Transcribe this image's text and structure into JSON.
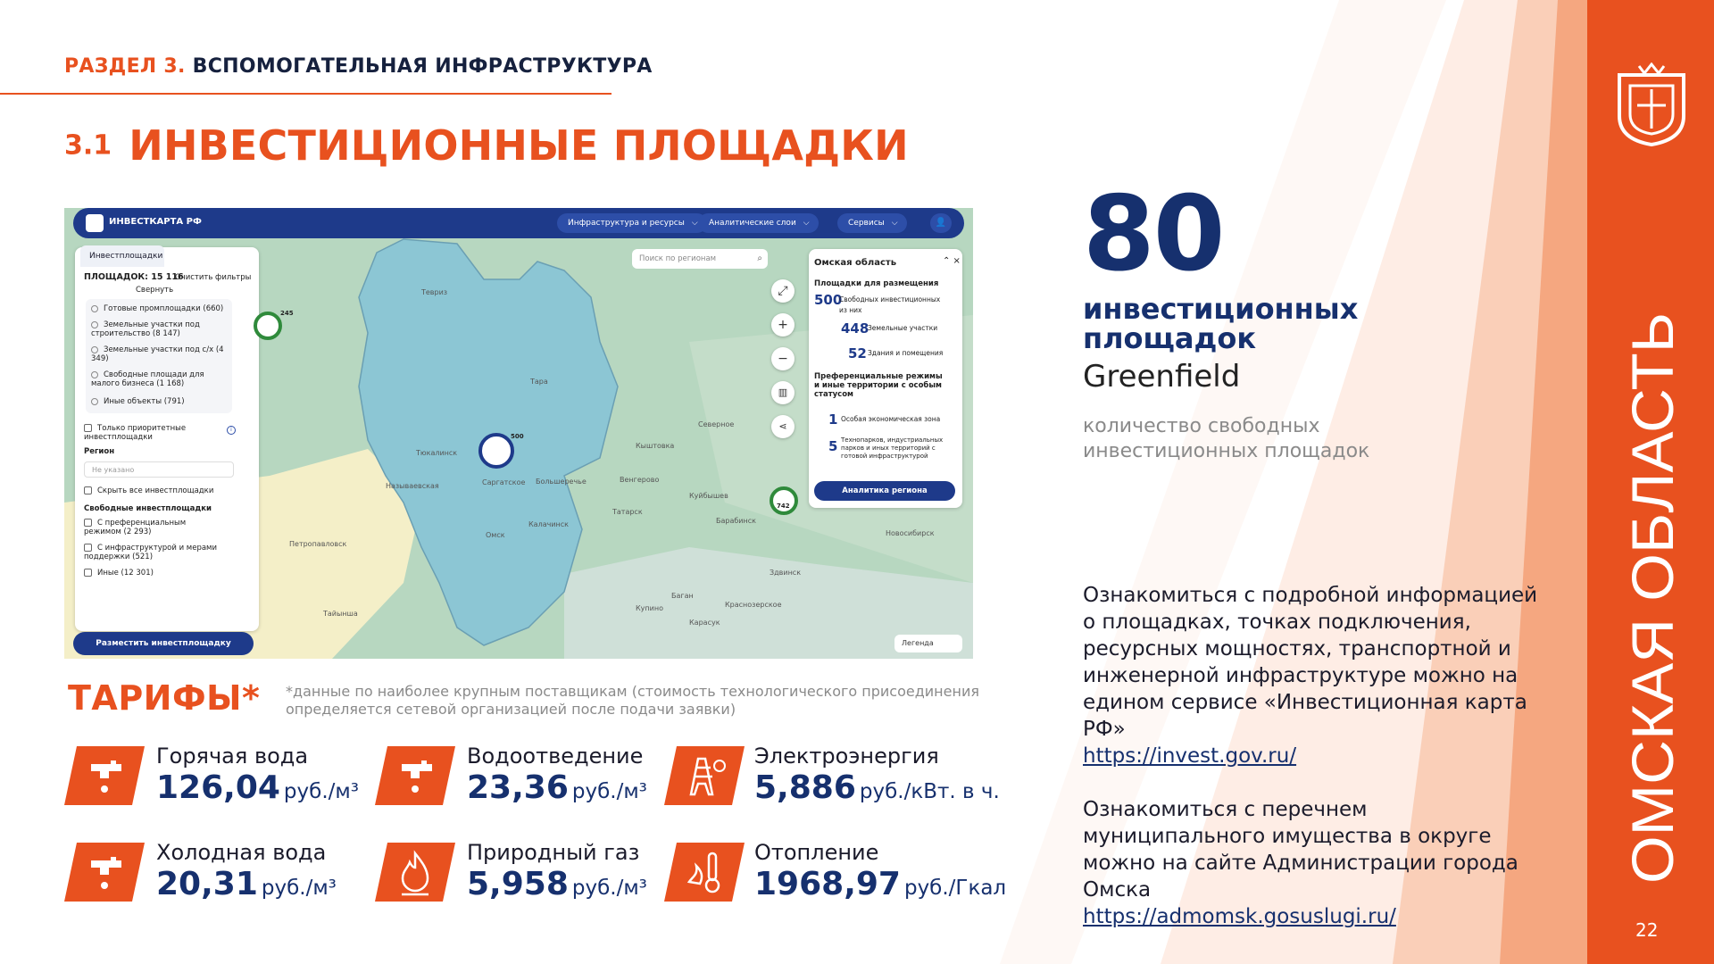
{
  "header": {
    "section_num": "РАЗДЕЛ 3.",
    "section_title": "ВСПОМОГАТЕЛЬНАЯ ИНФРАСТРУКТУРА",
    "title_num": "3.1",
    "title": "ИНВЕСТИЦИОННЫЕ ПЛОЩАДКИ"
  },
  "map": {
    "logo": "ИНВЕСТКАРТА РФ",
    "nav": [
      "Инфраструктура и ресурсы",
      "Аналитические слои",
      "Сервисы"
    ],
    "left_panel": {
      "tab": "Инвестплощадки",
      "count": "ПЛОЩАДОК: 15 116",
      "clear": "Очистить фильтры",
      "collapse": "Свернуть",
      "types": [
        "Готовые промплощадки (660)",
        "Земельные участки под строительство (8 147)",
        "Земельные участки под с/х (4 349)",
        "Свободные площади для малого бизнеса (1 168)",
        "Иные объекты (791)"
      ],
      "priority": "Только приоритетные инвестплощадки",
      "region_label": "Регион",
      "region_placeholder": "Не указано",
      "hide_all": "Скрыть все инвестплощадки",
      "free_label": "Свободные инвестплощадки",
      "free_items": [
        "С преференциальным режимом (2 293)",
        "С инфраструктурой и мерами поддержки (521)",
        "Иные (12 301)"
      ],
      "button": "Разместить инвестплощадку"
    },
    "search_placeholder": "Поиск по регионам",
    "right_panel": {
      "region": "Омская область",
      "placements_label": "Площадки для размещения",
      "free_count": "500",
      "free_text": "Свободных инвестиционных",
      "of_them": "из них",
      "land_count": "448",
      "land_text": "Земельные участки",
      "bld_count": "52",
      "bld_text": "Здания и помещения",
      "pref_label": "Преференциальные режимы и иные территории с особым статусом",
      "sez_count": "1",
      "sez_text": "Особая экономическая зона",
      "tech_count": "5",
      "tech_text": "Технопарков, индустриальных парков и иных территорий с готовой инфраструктурой",
      "button": "Аналитика региона"
    },
    "legend": "Легенда",
    "clusters": [
      "245",
      "500",
      "742"
    ],
    "cities": [
      "Тара",
      "Тевриз",
      "Называевская",
      "Саргатское",
      "Большеречье",
      "Омск",
      "Калачинск",
      "Тюкалинск",
      "Петропавловск",
      "Татарск",
      "Куйбышев",
      "Барабинск",
      "Новосибирск",
      "Карасук",
      "Купино",
      "Северное",
      "Кыштовка",
      "Венгерово",
      "Здвинск",
      "Баган",
      "Тайынша",
      "Краснозерское"
    ]
  },
  "stat": {
    "number": "80",
    "label_line1": "инвестиционных",
    "label_line2": "площадок",
    "sub": "Greenfield",
    "desc_line1": "количество свободных",
    "desc_line2": "инвестиционных площадок"
  },
  "info1": {
    "text": "Ознакомиться с подробной информацией о площадках, точках подключения, ресурсных мощностях, транспортной и инженерной инфраструктуре можно на едином сервисе «Инвестиционная карта РФ»",
    "link": "https://invest.gov.ru/"
  },
  "info2": {
    "text": "Ознакомиться с перечнем муниципального имущества в округе можно на сайте Администрации города Омска",
    "link": "https://admomsk.gosuslugi.ru/"
  },
  "tariffs": {
    "title": "ТАРИФЫ*",
    "note": "*данные по наиболее крупным поставщикам (стоимость технологического присоединения определяется сетевой организацией  после подачи заявки)",
    "items": [
      {
        "name": "Горячая вода",
        "value": "126,04",
        "unit": "руб./м³",
        "icon": "hot-water-tap-icon"
      },
      {
        "name": "Водоотведение",
        "value": "23,36",
        "unit": "руб./м³",
        "icon": "drainage-tap-icon"
      },
      {
        "name": "Электроэнергия",
        "value": "5,886",
        "unit": "руб./кВт. в ч.",
        "icon": "power-tower-icon"
      },
      {
        "name": "Холодная вода",
        "value": "20,31",
        "unit": "руб./м³",
        "icon": "cold-water-tap-icon"
      },
      {
        "name": "Природный газ",
        "value": "5,958",
        "unit": "руб./м³",
        "icon": "gas-flame-icon"
      },
      {
        "name": "Отопление",
        "value": "1968,97",
        "unit": "руб./Гкал",
        "icon": "heating-thermometer-icon"
      }
    ]
  },
  "brand": {
    "vertical": "ОМСКАЯ ОБЛАСТЬ",
    "page": "22"
  },
  "colors": {
    "accent": "#e8511f",
    "navy": "#16306e",
    "map_region": "#8cc6d4"
  }
}
